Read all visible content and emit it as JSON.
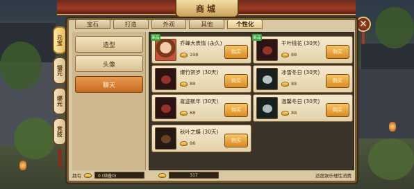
{
  "header": {
    "title": "商城"
  },
  "close_label": "✕",
  "side_tabs": [
    "元宝",
    "银元",
    "绑元",
    "竞技"
  ],
  "tabs": [
    "宝石",
    "打造",
    "外观",
    "其他",
    "个性化"
  ],
  "categories": [
    "造型",
    "头像",
    "聊天"
  ],
  "items": [
    {
      "name": "乔峰大表情 (永久)",
      "price": "198",
      "buy": "购买",
      "new": true,
      "thumb": "avatar"
    },
    {
      "name": "干叶桃花 (30天)",
      "price": "88",
      "buy": "购买",
      "new": true,
      "thumb": "red"
    },
    {
      "name": "爆竹贺岁 (30天)",
      "price": "88",
      "buy": "购买",
      "new": false,
      "thumb": "red"
    },
    {
      "name": "冰雪冬日 (30天)",
      "price": "88",
      "buy": "购买",
      "new": false,
      "thumb": "teal"
    },
    {
      "name": "喜迎新年 (30天)",
      "price": "88",
      "buy": "购买",
      "new": false,
      "thumb": "red"
    },
    {
      "name": "温馨冬日 (30天)",
      "price": "88",
      "buy": "购买",
      "new": false,
      "thumb": "teal"
    },
    {
      "name": "秋叶之蝶 (30天)",
      "price": "88",
      "buy": "购买",
      "new": false,
      "thumb": "dark"
    }
  ],
  "new_badge": "新品",
  "bottom": {
    "owned_label": "拥有",
    "owned_value": "0 (绑叠0)",
    "balance_value": "317",
    "note": "适度娱乐理性消费"
  }
}
